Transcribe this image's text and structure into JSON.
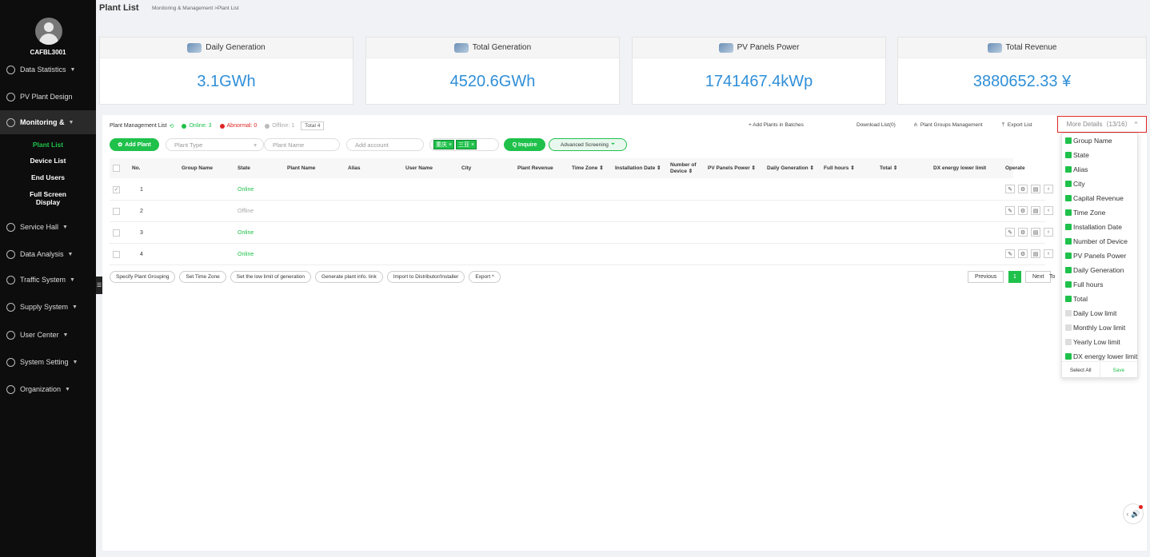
{
  "user": {
    "name": "CAFBL3001"
  },
  "header": {
    "title": "Plant List",
    "breadcrumb": "Monitoring & Management >Plant List"
  },
  "sidebar": {
    "items": [
      {
        "label": "Data Statistics",
        "caret": "▼"
      },
      {
        "label": "PV Plant Design"
      },
      {
        "label": "Monitoring &",
        "caret": "▼"
      },
      {
        "label": "Service Hall",
        "caret": "▼"
      },
      {
        "label": "Data Analysis",
        "caret": "▼"
      },
      {
        "label": "Traffic System",
        "caret": "▼"
      },
      {
        "label": "Supply System",
        "caret": "▼"
      },
      {
        "label": "User Center",
        "caret": "▼"
      },
      {
        "label": "System Setting",
        "caret": "▼"
      },
      {
        "label": "Organization",
        "caret": "▼"
      }
    ],
    "sub_items": [
      "Plant List",
      "Device List",
      "End Users",
      "Full Screen Display"
    ],
    "collapse_glyph": "☰"
  },
  "stats": [
    {
      "label": "Daily Generation",
      "value": "3.1GWh"
    },
    {
      "label": "Total Generation",
      "value": "4520.6GWh"
    },
    {
      "label": "PV Panels Power",
      "value": "1741467.4kWp"
    },
    {
      "label": "Total Revenue",
      "value": "3880652.33 ¥"
    }
  ],
  "toolbar": {
    "list_title": "Plant Management List",
    "online": "Online: 3",
    "abnormal": "Abnormal: 0",
    "offline": "Offline: 1",
    "total": "Total 4",
    "add_batches": "+ Add Plants in Batches",
    "download": "Download List(0)",
    "groups": "Plant Groups Management",
    "export_list": "Export List",
    "more_details": "More Details（13/16）",
    "more_details_caret": "^"
  },
  "filters": {
    "add_plant": "Add Plant",
    "plant_type": "Plant Type",
    "plant_name": "Plant Name",
    "add_account": "Add account",
    "tag1": "重庆 ×",
    "tag2": "三亚 ×",
    "inquire": "Q Inquire",
    "advanced": "Advanced Screening"
  },
  "table": {
    "columns": [
      "No.",
      "Group Name",
      "State",
      "Plant Name",
      "Alias",
      "User Name",
      "City",
      "Plant Revenue",
      "Time Zone ⇕",
      "Installation Date ⇕",
      "Number of Device ⇕",
      "PV Panels Power ⇕",
      "Daily Generation ⇕",
      "Full hours ⇕",
      "Total ⇕",
      "DX energy lower limit",
      "Operate"
    ],
    "rows": [
      {
        "no": "1",
        "state": "Online",
        "checked": "✓"
      },
      {
        "no": "2",
        "state": "Offline",
        "checked": ""
      },
      {
        "no": "3",
        "state": "Online",
        "checked": ""
      },
      {
        "no": "4",
        "state": "Online",
        "checked": ""
      }
    ],
    "op_icons": [
      "✎",
      "⚙",
      "▤",
      "‹"
    ]
  },
  "actions": [
    "Specify Plant Grouping",
    "Set Time Zone",
    "Set the low limit of generation",
    "Generate plant info. link",
    "Import to Distributor/Installer",
    "Export ^"
  ],
  "pager": {
    "previous": "Previous",
    "current": "1",
    "next": "Next",
    "to": "To"
  },
  "dropdown": {
    "items": [
      {
        "label": "Group Name",
        "checked": true
      },
      {
        "label": "State",
        "checked": true
      },
      {
        "label": "Alias",
        "checked": true
      },
      {
        "label": "City",
        "checked": true
      },
      {
        "label": "Capital Revenue",
        "checked": true
      },
      {
        "label": "Time Zone",
        "checked": true
      },
      {
        "label": "Installation Date",
        "checked": true
      },
      {
        "label": "Number of Device",
        "checked": true
      },
      {
        "label": "PV Panels Power",
        "checked": true
      },
      {
        "label": "Daily Generation",
        "checked": true
      },
      {
        "label": "Full hours",
        "checked": true
      },
      {
        "label": "Total",
        "checked": true
      },
      {
        "label": "Daily Low limit",
        "checked": false
      },
      {
        "label": "Monthly Low limit",
        "checked": false
      },
      {
        "label": "Yearly Low limit",
        "checked": false
      },
      {
        "label": "DX energy lower limit",
        "checked": true
      }
    ],
    "select_all": "Select All",
    "save": "Save"
  },
  "colors": {
    "accent": "#1fc14b",
    "value_blue": "#2f8fd8",
    "alert": "#e02424",
    "sidebar": "#0d0d0d"
  },
  "notify_icon": "🔊"
}
